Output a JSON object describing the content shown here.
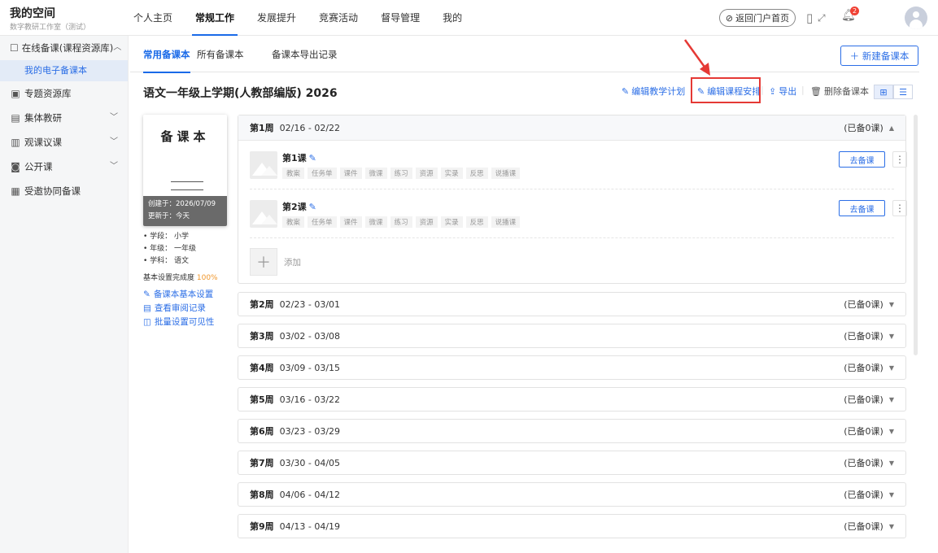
{
  "header": {
    "title": "我的空间",
    "subtitle": "数字教研工作室（测试）",
    "nav": [
      "个人主页",
      "常规工作",
      "发展提升",
      "竞赛活动",
      "督导管理",
      "我的"
    ],
    "active_nav": "常规工作",
    "portal_button": "返回门户首页",
    "notification_count": "2",
    "icons": [
      "phone-icon",
      "fullscreen-icon",
      "bell-icon",
      "avatar-icon"
    ]
  },
  "sidebar": {
    "items": [
      {
        "label": "在线备课(课程资源库)",
        "icon": "document-icon",
        "expanded": true
      },
      {
        "label": "专题资源库",
        "icon": "folder-icon"
      },
      {
        "label": "集体教研",
        "icon": "book-icon",
        "chevron": true
      },
      {
        "label": "观课议课",
        "icon": "chart-icon",
        "chevron": true
      },
      {
        "label": "公开课",
        "icon": "video-icon",
        "chevron": true
      },
      {
        "label": "受邀协同备课",
        "icon": "people-icon"
      }
    ],
    "subitem": "我的电子备课本"
  },
  "tabs": [
    "常用备课本",
    "所有备课本",
    "备课本导出记录"
  ],
  "new_button": "＋ 新建备课本",
  "book": {
    "title": "语文一年级上学期(人教部编版) 2026",
    "cover_title": "备课本",
    "created": "创建于：2026/07/09",
    "updated": "更新于：今天",
    "stage": "• 学段：  小学",
    "grade": "• 年级：  一年级",
    "subject": "• 学科：  语文",
    "completion_label": "基本设置完成度 ",
    "completion": "100%"
  },
  "actions": {
    "edit_plan": "编辑教学计划",
    "edit_schedule": "编辑课程安排",
    "export": "导出",
    "delete": "删除备课本"
  },
  "links": [
    "备课本基本设置",
    "查看审阅记录",
    "批量设置可见性"
  ],
  "weeks": [
    {
      "label": "第1周",
      "range": "02/16 - 02/22",
      "count": "(已备0课)",
      "expanded": true
    },
    {
      "label": "第2周",
      "range": "02/23 - 03/01",
      "count": "(已备0课)"
    },
    {
      "label": "第3周",
      "range": "03/02 - 03/08",
      "count": "(已备0课)"
    },
    {
      "label": "第4周",
      "range": "03/09 - 03/15",
      "count": "(已备0课)"
    },
    {
      "label": "第5周",
      "range": "03/16 - 03/22",
      "count": "(已备0课)"
    },
    {
      "label": "第6周",
      "range": "03/23 - 03/29",
      "count": "(已备0课)"
    },
    {
      "label": "第7周",
      "range": "03/30 - 04/05",
      "count": "(已备0课)"
    },
    {
      "label": "第8周",
      "range": "04/06 - 04/12",
      "count": "(已备0课)"
    },
    {
      "label": "第9周",
      "range": "04/13 - 04/19",
      "count": "(已备0课)"
    }
  ],
  "lessons": [
    {
      "name": "第1课",
      "tags": [
        "教案",
        "任务单",
        "课件",
        "微课",
        "练习",
        "资源",
        "实录",
        "反思",
        "说播课"
      ]
    },
    {
      "name": "第2课",
      "tags": [
        "教案",
        "任务单",
        "课件",
        "微课",
        "练习",
        "资源",
        "实录",
        "反思",
        "说播课"
      ]
    }
  ],
  "lesson_button": "去备课",
  "add_label": "添加",
  "colors": {
    "accent": "#2b6ee6",
    "highlight": "#e53935",
    "badge": "#f04134",
    "completion": "#f0962a"
  }
}
